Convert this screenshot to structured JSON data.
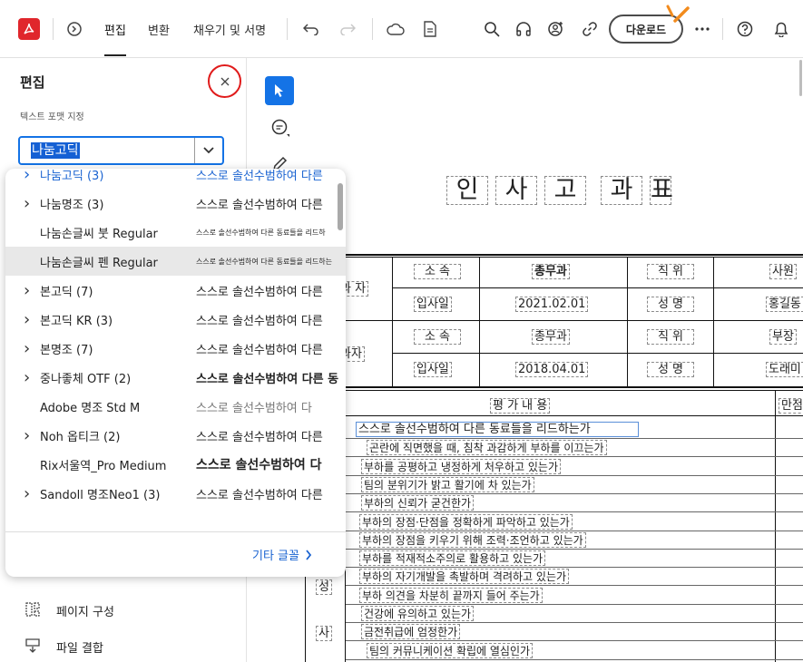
{
  "header": {
    "tabs": [
      "편집",
      "변환",
      "채우기 및 서명"
    ],
    "download_label": "다운로드",
    "colors": {
      "brand": "#e0262c",
      "accent": "#1473e6",
      "annotation_orange": "#f28b1d"
    }
  },
  "panel": {
    "title": "편집",
    "section_label": "텍스트 포맷 지정",
    "font_select_value": "나눔고딕",
    "fonts": [
      {
        "name": "나눔고딕 (3)",
        "preview": "스스로 솔선수범하여 다른",
        "expandable": true
      },
      {
        "name": "나눔명조 (3)",
        "preview": "스스로 솔선수범하여 다른",
        "expandable": true
      },
      {
        "name": "나눔손글씨 붓 Regular",
        "preview": "스스로 솔선수범하여 다른 동료들을 리드하",
        "expandable": false
      },
      {
        "name": "나눔손글씨 펜 Regular",
        "preview": "스스로 솔선수범하여 다른 동료들을 리드하는",
        "expandable": false
      },
      {
        "name": "본고딕 (7)",
        "preview": "스스로 솔선수범하여 다른",
        "expandable": true
      },
      {
        "name": "본고딕 KR (3)",
        "preview": "스스로 솔선수범하여 다른",
        "expandable": true
      },
      {
        "name": "본명조 (7)",
        "preview": "스스로 솔선수범하여 다른",
        "expandable": true
      },
      {
        "name": "중나좋체 OTF (2)",
        "preview": "스스로 솔선수범하여 다른 동",
        "expandable": true
      },
      {
        "name": "Adobe 명조 Std M",
        "preview": "스스로 솔선수범하여 다",
        "expandable": false
      },
      {
        "name": "Noh 옵티크 (2)",
        "preview": "스스로 솔선수범하여 다른",
        "expandable": true
      },
      {
        "name": "Rix서울역_Pro Medium",
        "preview": "스스로 솔선수범하여 다",
        "expandable": false
      },
      {
        "name": "Sandoll 명조Neo1 (3)",
        "preview": "스스로 솔선수범하여 다른",
        "expandable": true
      }
    ],
    "other_fonts_label": "기타 글꼴",
    "bottom_items": [
      "페이지 구성",
      "파일 결합"
    ]
  },
  "document": {
    "title_chars": [
      "인",
      "사",
      "고",
      "과",
      "표"
    ],
    "info_rows": [
      {
        "group": "과 자",
        "label1": "소 속",
        "value1": "총무과",
        "label2": "직 위",
        "value2": "사원"
      },
      {
        "group": "",
        "label1": "입사일",
        "value1": "2021.02.01",
        "label2": "성 명",
        "value2": "홍길동"
      },
      {
        "group": "과자",
        "label1": "소 속",
        "value1": "총무과",
        "label2": "직 위",
        "value2": "부장"
      },
      {
        "group": "",
        "label1": "입사일",
        "value1": "2018.04.01",
        "label2": "성 명",
        "value2": "도래미"
      }
    ],
    "eval_header": "평 가 내 용",
    "score_header": "만점",
    "side_labels": [
      "성",
      "사"
    ],
    "items": [
      "스스로 솔선수범하여 다른 동료들을 리드하는가",
      "곤란에 직면했을 때, 침착 과감하게 부하를 이끄는가",
      "부하를 공평하고 냉정하게 처우하고 있는가",
      "팀의 분위기가 밝고 활기에 차 있는가",
      "부하의 신뢰가 굳건한가",
      "부하의 장점·단점을 정확하게 파악하고 있는가",
      "부하의 장점을 키우기 위해 조력·조언하고 있는가",
      "부하를 적재적소주의로 활용하고 있는가",
      "부하의 자기개발을 촉발하며 격려하고 있는가",
      "부하 의견을 차분히 끝까지 들어 주는가",
      "건강에 유의하고 있는가",
      "금전취급에 엄정한가",
      "팀의 커뮤니케이션 확립에 열심인가"
    ]
  }
}
